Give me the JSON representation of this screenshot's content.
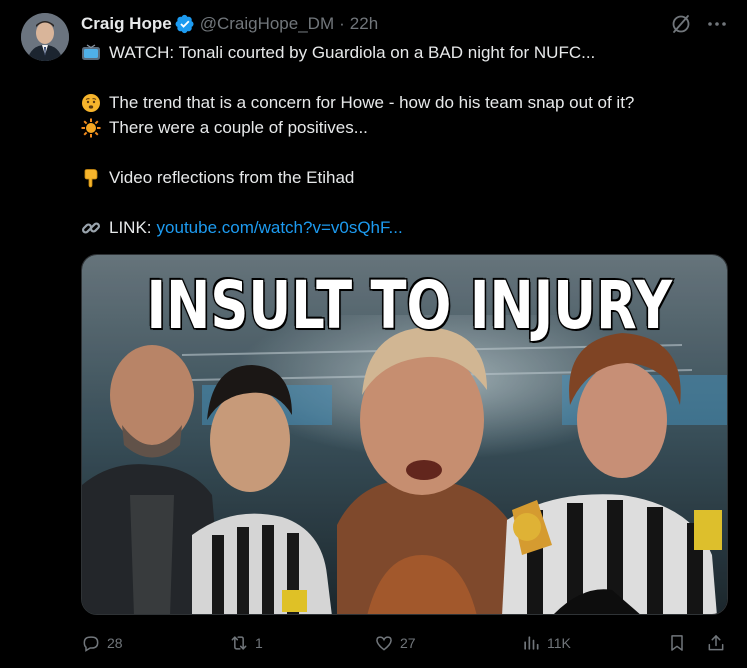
{
  "author": {
    "name": "Craig Hope",
    "handle": "@CraigHope_DM",
    "separator": "·",
    "time": "22h"
  },
  "tweet": {
    "line1": "WATCH: Tonali courted by Guardiola on a BAD night for NUFC...",
    "line2": "The trend that is a concern for Howe - how do his team snap out of it?",
    "line3": "There were a couple of positives...",
    "line4": "Video reflections from the Etihad",
    "link_label": "LINK:",
    "link_url": "youtube.com/watch?v=v0sQhF..."
  },
  "media": {
    "title": "INSULT TO INJURY"
  },
  "actions": {
    "replies": "28",
    "reposts": "1",
    "likes": "27",
    "views": "11K"
  },
  "colors": {
    "background": "#000000",
    "text": "#e7e9ea",
    "muted": "#71767b",
    "link": "#1d9bf0",
    "verified": "#1d9bf0"
  },
  "icons": {
    "line1": "television-icon",
    "line2": "worried-face-icon",
    "line3": "sun-icon",
    "line4": "pointing-down-icon",
    "link": "link-icon"
  }
}
